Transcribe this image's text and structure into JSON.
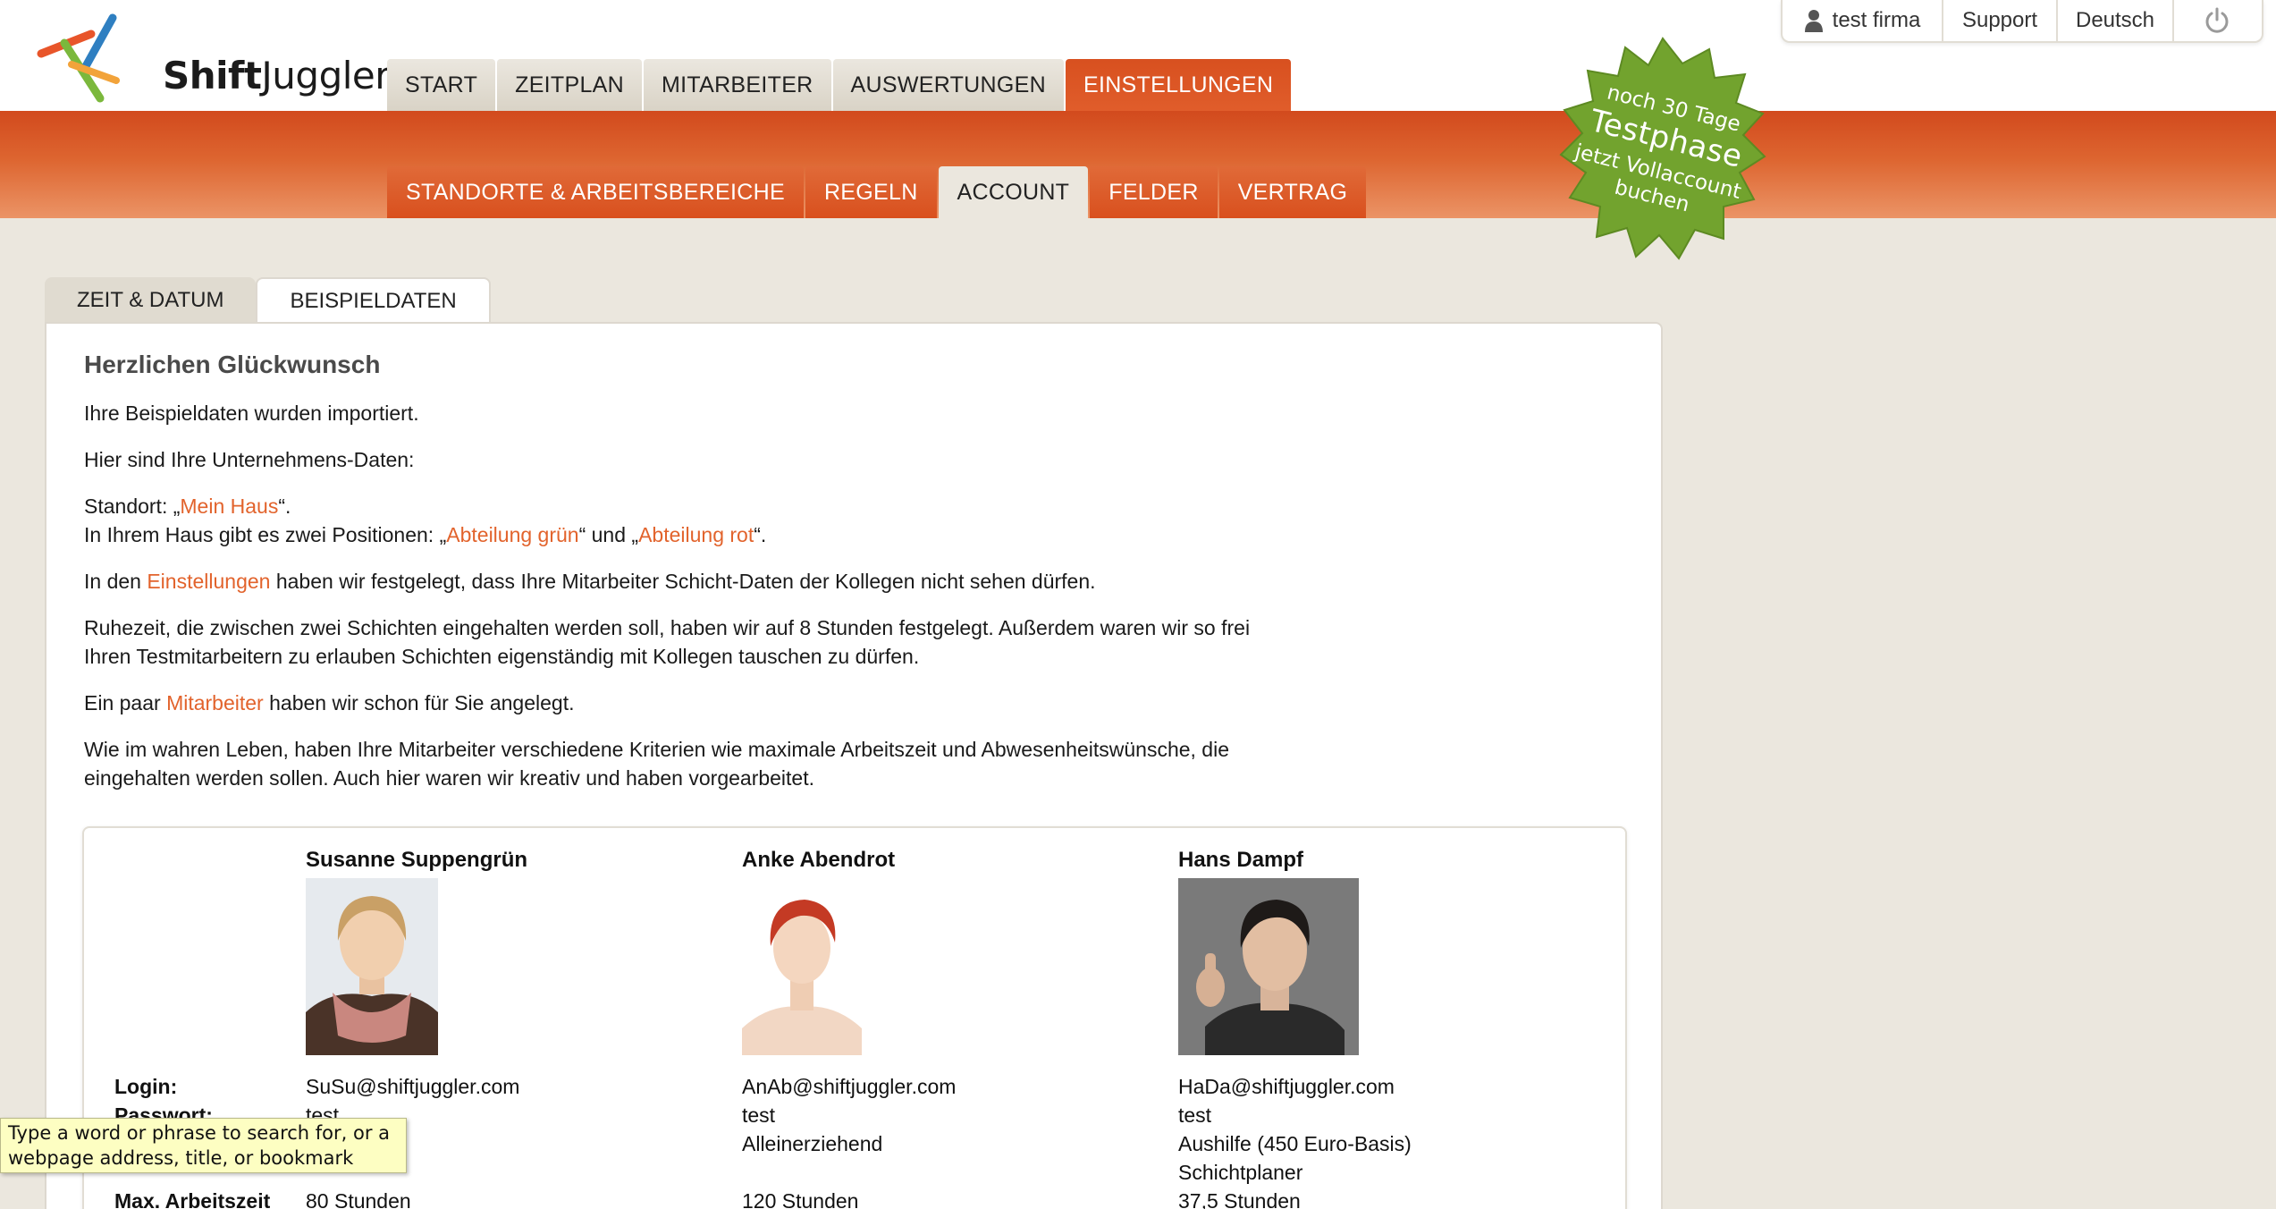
{
  "brand": {
    "logo_bold": "Shift",
    "logo_rest": "Juggler"
  },
  "util_bar": {
    "user": "test firma",
    "support": "Support",
    "language": "Deutsch"
  },
  "main_tabs": [
    "START",
    "ZEITPLAN",
    "MITARBEITER",
    "AUSWERTUNGEN",
    "EINSTELLUNGEN"
  ],
  "sub_tabs": [
    "STANDORTE & ARBEITSBEREICHE",
    "REGELN",
    "ACCOUNT",
    "FELDER",
    "VERTRAG"
  ],
  "badge": {
    "line1": "noch 30 Tage",
    "line2": "Testphase",
    "line3": "jetzt Vollaccount",
    "line4": "buchen"
  },
  "content_tabs": [
    "ZEIT & DATUM",
    "BEISPIELDATEN"
  ],
  "content": {
    "title": "Herzlichen Glückwunsch",
    "p1": "Ihre Beispieldaten wurden importiert.",
    "p2": "Hier sind Ihre Unternehmens-Daten:",
    "p3a": "Standort: „",
    "p3_link": "Mein Haus",
    "p3b": "“.",
    "p4a": "In Ihrem Haus gibt es zwei Positionen: „",
    "p4_link1": "Abteilung grün",
    "p4b": "“ und „",
    "p4_link2": "Abteilung rot",
    "p4c": "“.",
    "p5a": "In den ",
    "p5_link": "Einstellungen",
    "p5b": " haben wir festgelegt, dass Ihre Mitarbeiter Schicht-Daten der Kollegen nicht sehen dürfen.",
    "p6a": "Ruhezeit, die zwischen zwei Schichten eingehalten werden soll, haben wir auf 8 Stunden festgelegt. Außerdem waren wir so frei",
    "p6b": "Ihren Testmitarbeitern zu erlauben Schichten eigenständig mit Kollegen tauschen zu dürfen.",
    "p7a": "Ein paar ",
    "p7_link": "Mitarbeiter",
    "p7b": " haben wir schon für Sie angelegt.",
    "p8a": "Wie im wahren Leben, haben Ihre Mitarbeiter verschiedene Kriterien wie maximale Arbeitszeit und Abwesenheitswünsche, die",
    "p8b": "eingehalten werden sollen. Auch hier waren wir kreativ und haben vorgearbeitet."
  },
  "row_labels": {
    "login": "Login:",
    "password": "Passwort:",
    "max_hours": "Max. Arbeitszeit"
  },
  "employees": [
    {
      "name": "Susanne Suppengrün",
      "login": "SuSu@shiftjuggler.com",
      "password": "test",
      "extra1": "",
      "extra2": "",
      "max_hours": "80 Stunden"
    },
    {
      "name": "Anke Abendrot",
      "login": "AnAb@shiftjuggler.com",
      "password": "test",
      "extra1": "Alleinerziehend",
      "extra2": "",
      "max_hours": "120 Stunden"
    },
    {
      "name": "Hans Dampf",
      "login": "HaDa@shiftjuggler.com",
      "password": "test",
      "extra1": "Aushilfe (450 Euro-Basis)",
      "extra2": "Schichtplaner",
      "max_hours": "37,5 Stunden"
    }
  ],
  "tooltip": {
    "line1": "Type a word or phrase to search for, or a",
    "line2": "webpage address, title, or bookmark"
  },
  "colors": {
    "orange": "#e05d2b",
    "badge_green": "#6fa02b",
    "background": "#ebe7de"
  }
}
